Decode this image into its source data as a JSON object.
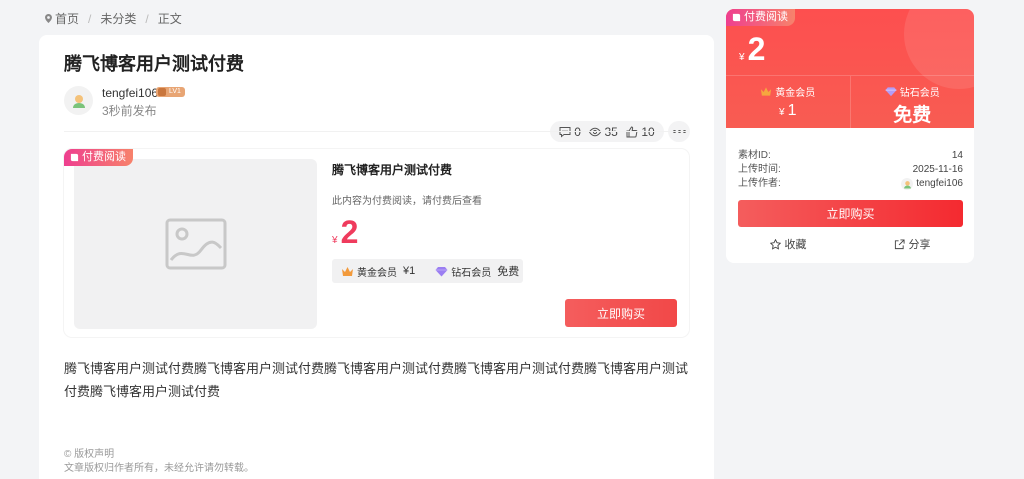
{
  "breadcrumb": {
    "items": [
      "首页",
      "未分类",
      "正文"
    ]
  },
  "post": {
    "title": "腾飞博客用户测试付费",
    "author": "tengfei106",
    "level": "LV1",
    "publish_time": "3秒前发布",
    "stats": {
      "comments": "0",
      "views": "35",
      "likes": "10"
    },
    "body": "腾飞博客用户测试付费腾飞博客用户测试付费腾飞博客用户测试付费腾飞博客用户测试付费腾飞博客用户测试付费腾飞博客用户测试付费",
    "copyright_title": "© 版权声明",
    "copyright_text": "文章版权归作者所有，未经允许请勿转载。"
  },
  "paid": {
    "tag": "付费阅读",
    "title": "腾飞博客用户测试付费",
    "desc": "此内容为付费阅读，请付费后查看",
    "currency": "¥",
    "price": "2",
    "gold_label": "黄金会员",
    "gold_price": "¥1",
    "diamond_label": "钻石会员",
    "diamond_price": "免费",
    "buy_label": "立即购买"
  },
  "sidebar": {
    "tag": "付费阅读",
    "currency": "¥",
    "price": "2",
    "gold_label": "黄金会员",
    "gold_price": "1",
    "diamond_label": "钻石会员",
    "diamond_price": "免费",
    "meta": [
      {
        "label": "素材ID:",
        "value": "14"
      },
      {
        "label": "上传时间:",
        "value": "2025-11-16"
      },
      {
        "label": "上传作者:",
        "value": "tengfei106"
      }
    ],
    "buy_label": "立即购买",
    "favorite_label": "收藏",
    "share_label": "分享"
  },
  "colors": {
    "accent_red": "#f24848",
    "price_pink": "#ef3b5d",
    "tag_gradient_start": "#ee3f8f",
    "tag_gradient_end": "#f7826b"
  }
}
